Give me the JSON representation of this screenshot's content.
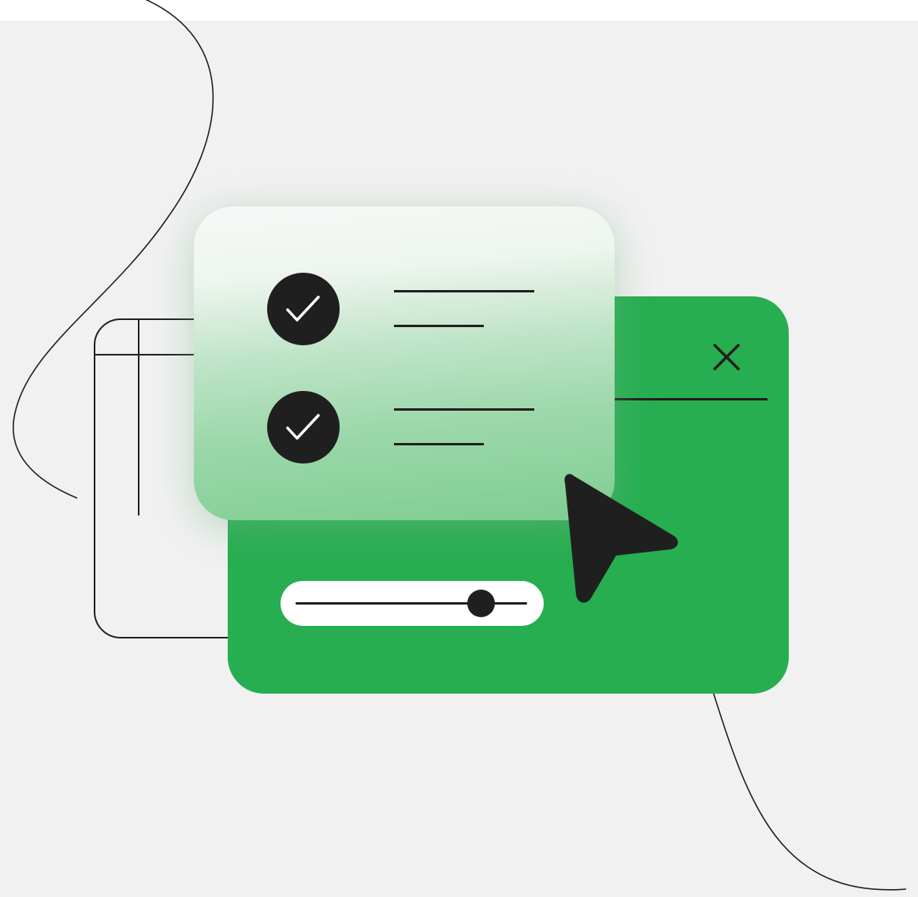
{
  "illustration": {
    "colors": {
      "background": "#f1f1f1",
      "accent_green": "#27ae51",
      "ink": "#1f1f1f",
      "card_frost": "#eef5ef"
    },
    "icons": [
      "close-icon",
      "check-icon",
      "check-icon",
      "mouse-pointer-icon"
    ],
    "checklist": {
      "items": [
        {
          "checked": true
        },
        {
          "checked": true
        }
      ]
    },
    "slider": {
      "value_fraction": 0.8
    }
  }
}
